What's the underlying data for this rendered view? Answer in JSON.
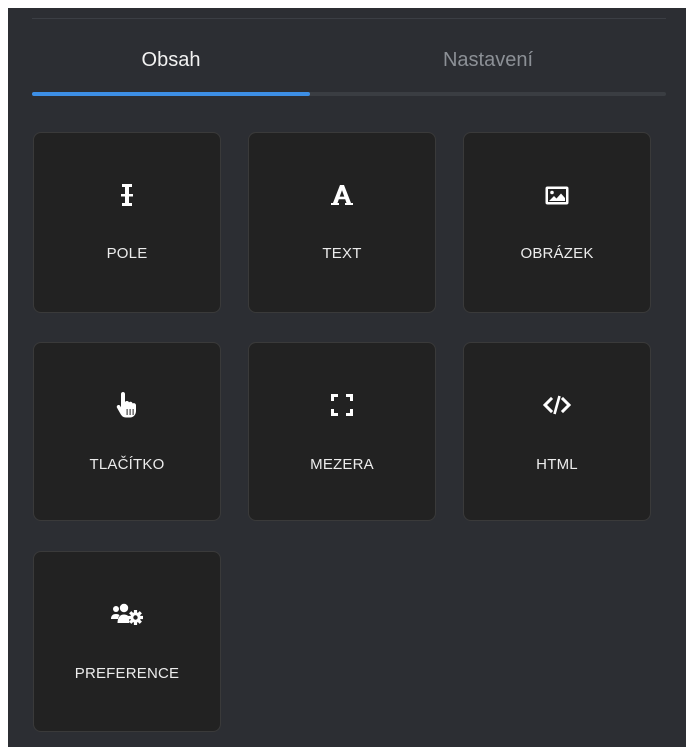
{
  "tabs": [
    {
      "label": "Obsah",
      "active": true
    },
    {
      "label": "Nastavení",
      "active": false
    }
  ],
  "tiles": [
    {
      "label": "POLE",
      "icon": "text-cursor-icon"
    },
    {
      "label": "TEXT",
      "icon": "letter-a-icon"
    },
    {
      "label": "OBRÁZEK",
      "icon": "image-icon"
    },
    {
      "label": "TLAČÍTKO",
      "icon": "hand-pointer-icon"
    },
    {
      "label": "MEZERA",
      "icon": "spacer-corners-icon"
    },
    {
      "label": "HTML",
      "icon": "code-icon"
    },
    {
      "label": "PREFERENCE",
      "icon": "users-cog-icon"
    }
  ],
  "colors": {
    "panel_bg": "#2c2e33",
    "tile_bg": "#222222",
    "accent": "#3d8fe6",
    "active_tab_text": "#f2f2f2",
    "inactive_tab_text": "#8c9096"
  }
}
